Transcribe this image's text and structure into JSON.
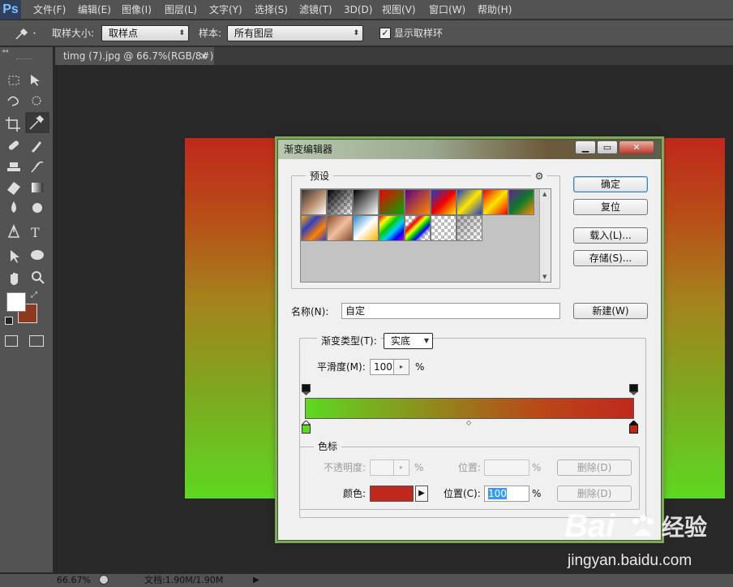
{
  "app": {
    "logo": "Ps"
  },
  "menu": [
    "文件(F)",
    "编辑(E)",
    "图像(I)",
    "图层(L)",
    "文字(Y)",
    "选择(S)",
    "滤镜(T)",
    "3D(D)",
    "视图(V)",
    "窗口(W)",
    "帮助(H)"
  ],
  "options": {
    "sample_size_label": "取样大小:",
    "sample_size_value": "取样点",
    "sample_label": "样本:",
    "sample_value": "所有图层",
    "show_ring_label": "显示取样环",
    "show_ring_checked": true
  },
  "document_tab": {
    "title": "timg (7).jpg @ 66.7%(RGB/8#)",
    "close": "×"
  },
  "tools": [
    "marquee-icon",
    "move-icon",
    "lasso-icon",
    "quick-select-icon",
    "crop-icon",
    "eyedropper-icon",
    "healing-icon",
    "brush-icon",
    "stamp-icon",
    "history-brush-icon",
    "eraser-icon",
    "gradient-icon",
    "blur-icon",
    "dodge-icon",
    "pen-icon",
    "type-icon",
    "path-select-icon",
    "shape-icon",
    "hand-icon",
    "zoom-icon"
  ],
  "type_tool_glyph": "T",
  "colors": {
    "foreground": "#ffffff",
    "background": "#8b3a1e",
    "gradient_start": "#5ed821",
    "gradient_end": "#c0281c"
  },
  "status": {
    "zoom": "66.67%",
    "doc": "文档:1.90M/1.90M"
  },
  "dialog": {
    "title": "渐变编辑器",
    "presets_label": "预设",
    "ok": "确定",
    "reset": "复位",
    "load": "载入(L)...",
    "save": "存储(S)...",
    "name_label": "名称(N):",
    "name_value": "自定",
    "new": "新建(W)",
    "gradient_type_label": "渐变类型(T):",
    "gradient_type_value": "实底",
    "smoothness_label": "平滑度(M):",
    "smoothness_value": "100",
    "percent": "%",
    "stops_group": "色标",
    "opacity_label": "不透明度:",
    "location_label": "位置:",
    "delete": "删除(D)",
    "color_label": "颜色:",
    "color_location_label": "位置(C):",
    "color_location_value": "100",
    "selected_stop_color": "#c0281c"
  },
  "watermark": {
    "brand": "Bai",
    "brand2": "经验",
    "url": "jingyan.baidu.com"
  }
}
